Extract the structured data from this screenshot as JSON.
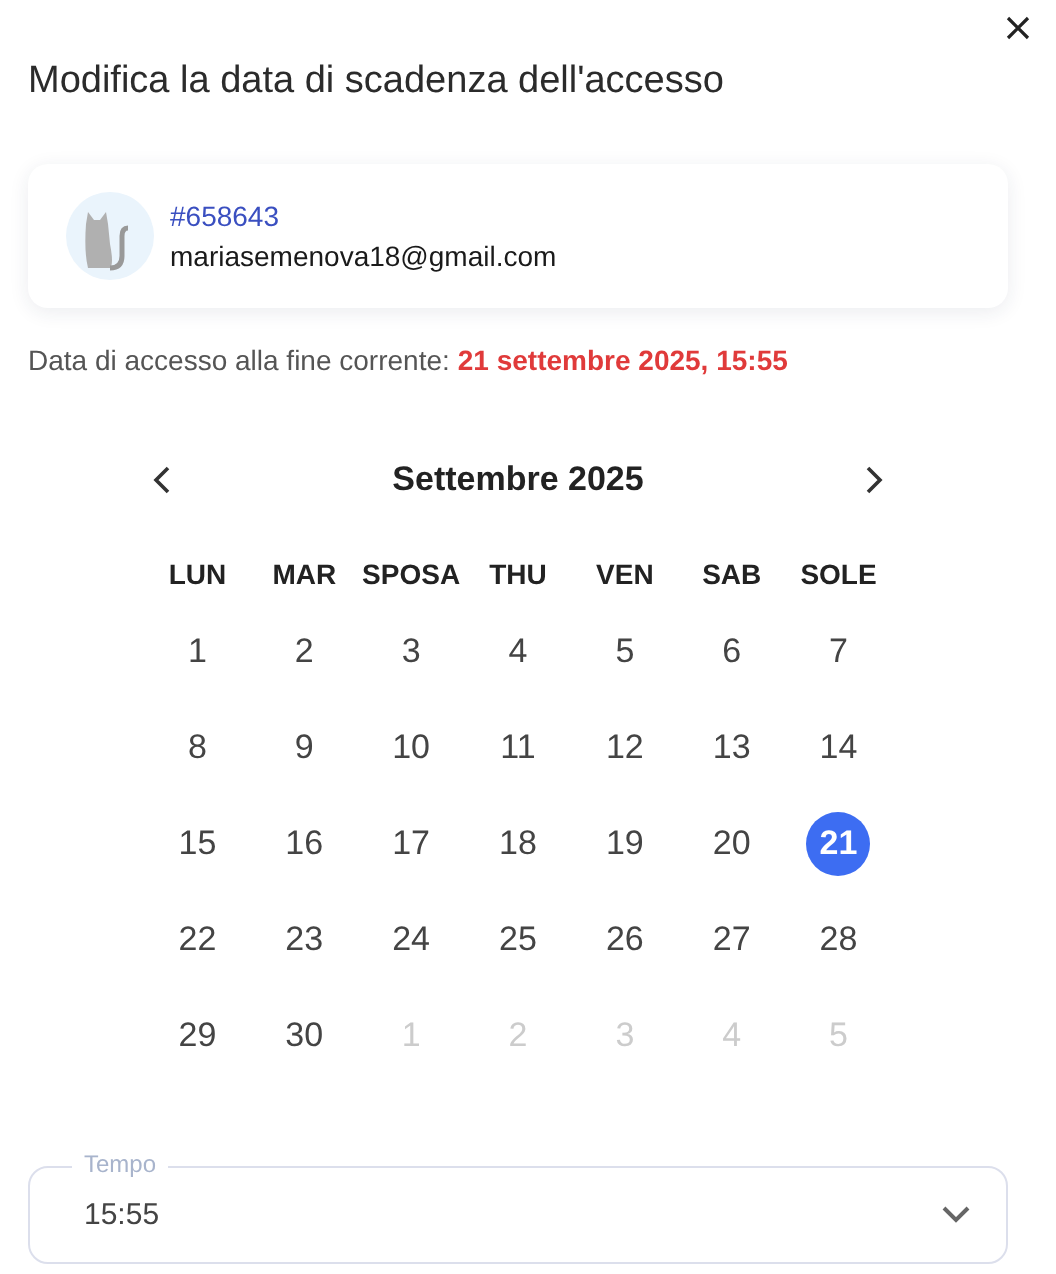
{
  "dialog": {
    "title": "Modifica la data di scadenza dell'accesso"
  },
  "user": {
    "id": "#658643",
    "email": "mariasemenova18@gmail.com"
  },
  "current": {
    "label": "Data di accesso alla fine corrente:",
    "value": "21 settembre 2025, 15:55"
  },
  "calendar": {
    "month": "Settembre 2025",
    "weekdays": [
      "LUN",
      "MAR",
      "SPOSA",
      "THU",
      "VEN",
      "SAB",
      "SOLE"
    ],
    "days": [
      {
        "label": "1",
        "outside": false,
        "selected": false
      },
      {
        "label": "2",
        "outside": false,
        "selected": false
      },
      {
        "label": "3",
        "outside": false,
        "selected": false
      },
      {
        "label": "4",
        "outside": false,
        "selected": false
      },
      {
        "label": "5",
        "outside": false,
        "selected": false
      },
      {
        "label": "6",
        "outside": false,
        "selected": false
      },
      {
        "label": "7",
        "outside": false,
        "selected": false
      },
      {
        "label": "8",
        "outside": false,
        "selected": false
      },
      {
        "label": "9",
        "outside": false,
        "selected": false
      },
      {
        "label": "10",
        "outside": false,
        "selected": false
      },
      {
        "label": "11",
        "outside": false,
        "selected": false
      },
      {
        "label": "12",
        "outside": false,
        "selected": false
      },
      {
        "label": "13",
        "outside": false,
        "selected": false
      },
      {
        "label": "14",
        "outside": false,
        "selected": false
      },
      {
        "label": "15",
        "outside": false,
        "selected": false
      },
      {
        "label": "16",
        "outside": false,
        "selected": false
      },
      {
        "label": "17",
        "outside": false,
        "selected": false
      },
      {
        "label": "18",
        "outside": false,
        "selected": false
      },
      {
        "label": "19",
        "outside": false,
        "selected": false
      },
      {
        "label": "20",
        "outside": false,
        "selected": false
      },
      {
        "label": "21",
        "outside": false,
        "selected": true
      },
      {
        "label": "22",
        "outside": false,
        "selected": false
      },
      {
        "label": "23",
        "outside": false,
        "selected": false
      },
      {
        "label": "24",
        "outside": false,
        "selected": false
      },
      {
        "label": "25",
        "outside": false,
        "selected": false
      },
      {
        "label": "26",
        "outside": false,
        "selected": false
      },
      {
        "label": "27",
        "outside": false,
        "selected": false
      },
      {
        "label": "28",
        "outside": false,
        "selected": false
      },
      {
        "label": "29",
        "outside": false,
        "selected": false
      },
      {
        "label": "30",
        "outside": false,
        "selected": false
      },
      {
        "label": "1",
        "outside": true,
        "selected": false
      },
      {
        "label": "2",
        "outside": true,
        "selected": false
      },
      {
        "label": "3",
        "outside": true,
        "selected": false
      },
      {
        "label": "4",
        "outside": true,
        "selected": false
      },
      {
        "label": "5",
        "outside": true,
        "selected": false
      }
    ]
  },
  "time_field": {
    "label": "Tempo",
    "value": "15:55"
  }
}
